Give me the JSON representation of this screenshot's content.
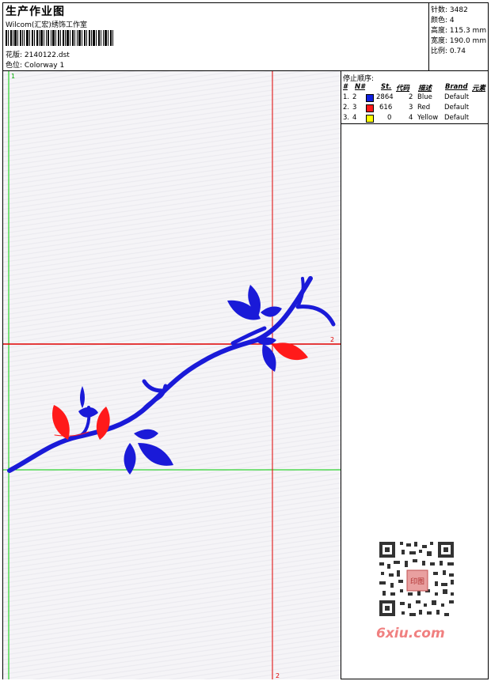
{
  "header": {
    "title": "生产作业图",
    "studio": "Wilcom(汇宏)绣饰工作室",
    "design_label": "花版:",
    "design_value": "2140122.dst",
    "colorway_label": "色位:",
    "colorway_value": "Colorway 1"
  },
  "stats": {
    "stitches_label": "针数:",
    "stitches_value": "3482",
    "colors_label": "颜色:",
    "colors_value": "4",
    "height_label": "高度:",
    "height_value": "115.3 mm",
    "width_label": "宽度:",
    "width_value": "190.0 mm",
    "scale_label": "比例:",
    "scale_value": "0.74"
  },
  "stop_sequence": {
    "title": "停止顺序:",
    "columns": [
      "#",
      "N#",
      "St.",
      "代码",
      "描述",
      "Brand",
      "元素"
    ],
    "rows": [
      {
        "idx": "1.",
        "n": "2",
        "color": "#1020e0",
        "st": "2864",
        "code": "2",
        "desc": "Blue",
        "brand": "Default"
      },
      {
        "idx": "2.",
        "n": "3",
        "color": "#ff1a1a",
        "st": "616",
        "code": "3",
        "desc": "Red",
        "brand": "Default"
      },
      {
        "idx": "3.",
        "n": "4",
        "color": "#ffff00",
        "st": "0",
        "code": "4",
        "desc": "Yellow",
        "brand": "Default"
      }
    ]
  },
  "canvas": {
    "marker_top": "1",
    "marker_right": "2",
    "marker_bottom": "2",
    "colors": {
      "stem": "#1a1ad8",
      "leaf_red": "#ff1a1a",
      "guide_red": "#e00000",
      "guide_green": "#00cc00"
    }
  },
  "watermark": {
    "brand": "6xiu.com",
    "seal": "印图"
  }
}
